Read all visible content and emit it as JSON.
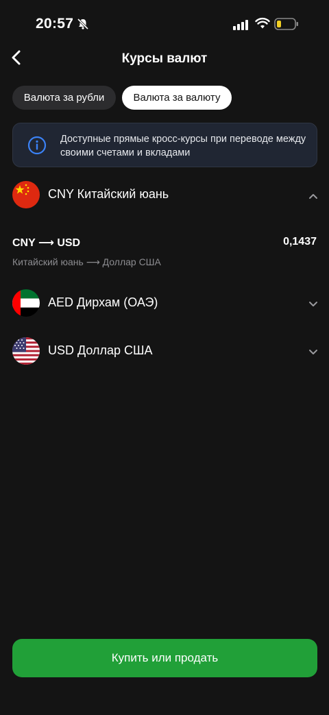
{
  "status": {
    "time": "20:57"
  },
  "header": {
    "title": "Курсы валют"
  },
  "tabs": [
    {
      "label": "Валюта за рубли",
      "active": false
    },
    {
      "label": "Валюта за валюту",
      "active": true
    }
  ],
  "info": {
    "text": "Доступные прямые кросс-курсы при переводе между своими счетами и вкладами"
  },
  "currencies": [
    {
      "code": "CNY",
      "label": "CNY Китайский юань",
      "flag": "china-flag",
      "expanded": true
    },
    {
      "code": "AED",
      "label": "AED Дирхам (ОАЭ)",
      "flag": "uae-flag",
      "expanded": false
    },
    {
      "code": "USD",
      "label": "USD Доллар США",
      "flag": "usa-flag",
      "expanded": false
    }
  ],
  "rate": {
    "pair": "CNY ⟶ USD",
    "value": "0,1437",
    "description": "Китайский юань ⟶ Доллар США"
  },
  "action": {
    "label": "Купить или продать"
  },
  "colors": {
    "background": "#141414",
    "accent_green": "#21a038",
    "info_bg": "#202633",
    "info_icon": "#3b82f6",
    "muted_text": "#8c8c90"
  }
}
